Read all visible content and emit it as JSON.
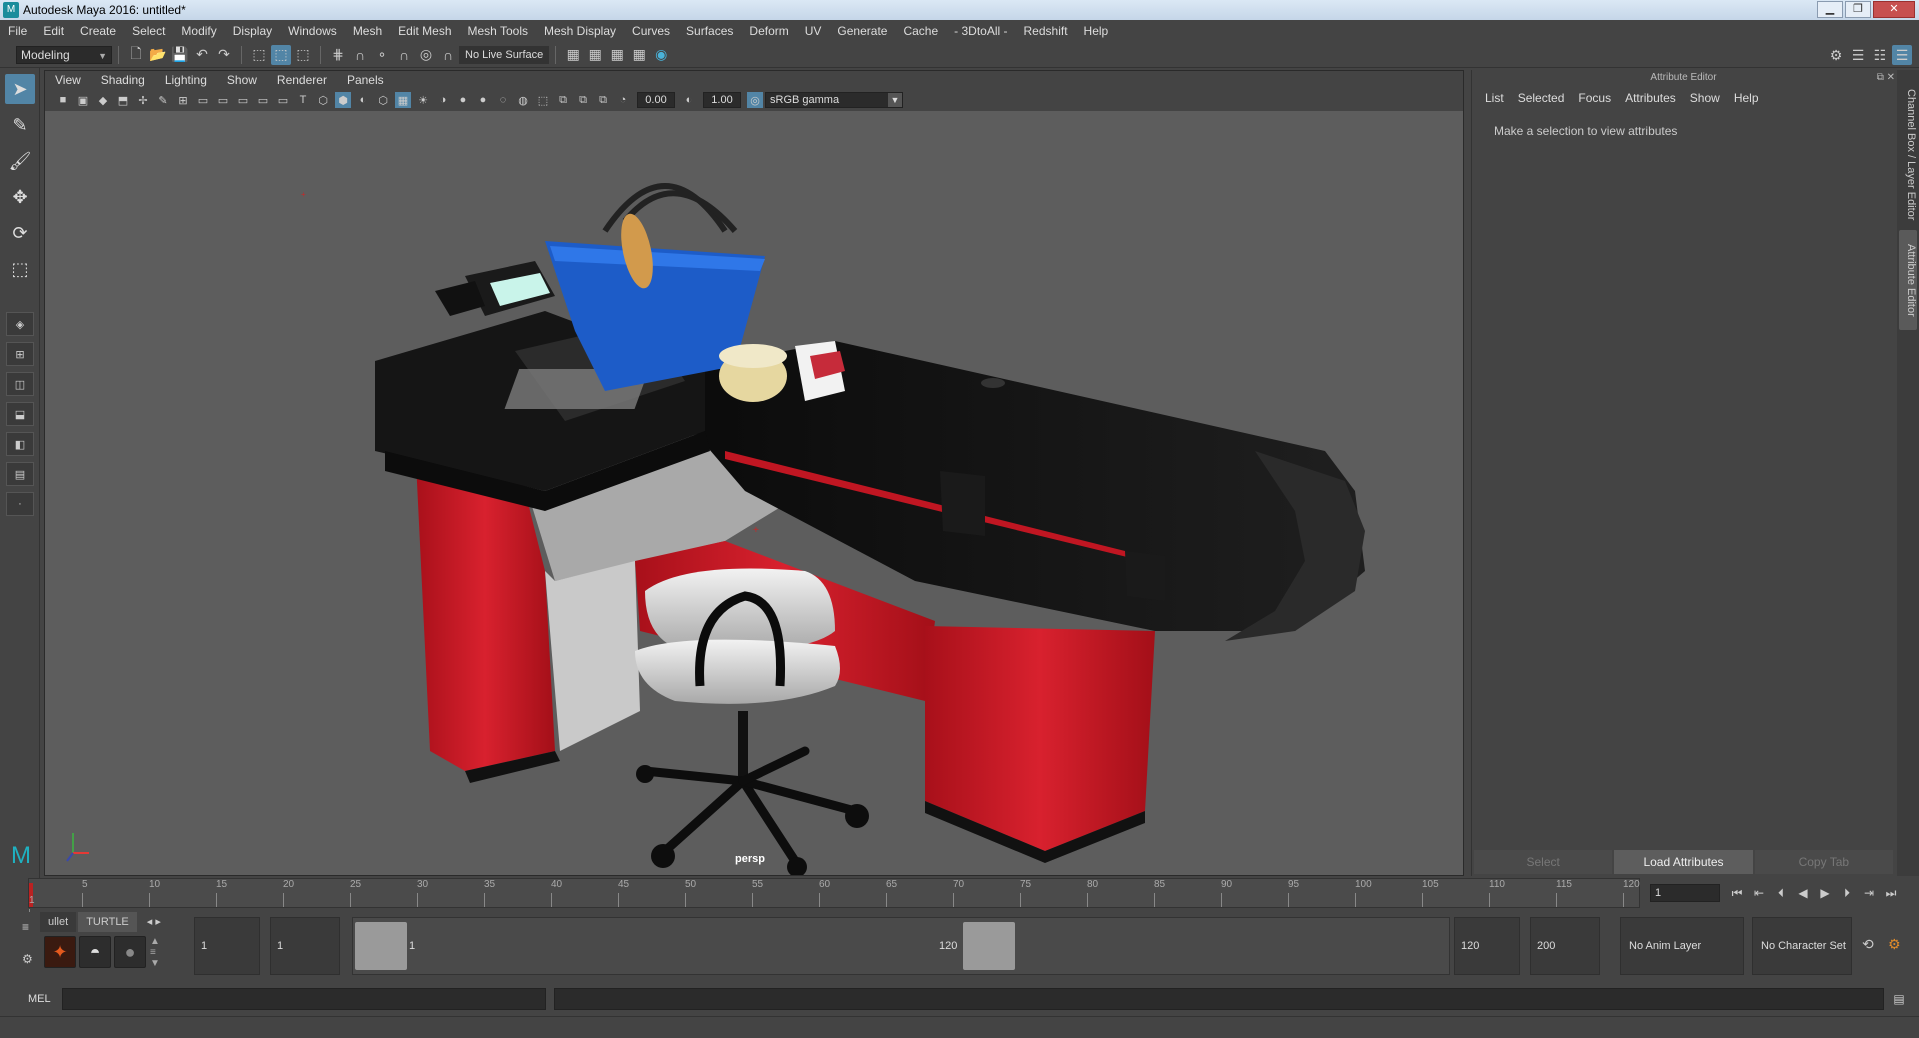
{
  "window": {
    "title": "Autodesk Maya 2016: untitled*",
    "app_icon": "maya-logo-icon"
  },
  "menus": [
    "File",
    "Edit",
    "Create",
    "Select",
    "Modify",
    "Display",
    "Windows",
    "Mesh",
    "Edit Mesh",
    "Mesh Tools",
    "Mesh Display",
    "Curves",
    "Surfaces",
    "Deform",
    "UV",
    "Generate",
    "Cache",
    "- 3DtoAll -",
    "Redshift",
    "Help"
  ],
  "status_line": {
    "mode": "Modeling",
    "live_surface": "No Live Surface"
  },
  "viewport": {
    "menus": [
      "View",
      "Shading",
      "Lighting",
      "Show",
      "Renderer",
      "Panels"
    ],
    "exposure": "0.00",
    "gamma": "1.00",
    "color_space": "sRGB gamma",
    "camera_label": "persp"
  },
  "attribute_editor": {
    "title": "Attribute Editor",
    "menus": [
      "List",
      "Selected",
      "Focus",
      "Attributes",
      "Show",
      "Help"
    ],
    "message": "Make a selection to view attributes",
    "buttons": {
      "select": "Select",
      "load": "Load Attributes",
      "copy": "Copy Tab"
    }
  },
  "side_tabs": {
    "channel_box": "Channel Box / Layer Editor",
    "attr_editor": "Attribute Editor"
  },
  "timeline": {
    "ticks": [
      "5",
      "10",
      "15",
      "20",
      "25",
      "30",
      "35",
      "40",
      "45",
      "50",
      "55",
      "60",
      "65",
      "70",
      "75",
      "80",
      "85",
      "90",
      "95",
      "100",
      "105",
      "110",
      "115",
      "120"
    ],
    "start_tick": "1",
    "current_frame": "1"
  },
  "shelf": {
    "tabs": [
      "ullet",
      "TURTLE"
    ],
    "active_tab": "TURTLE"
  },
  "range": {
    "start": "1",
    "playback_start": "1",
    "slider_start": "1",
    "slider_end": "120",
    "playback_end": "120",
    "end": "200",
    "anim_layer": "No Anim Layer",
    "character_set": "No Character Set"
  },
  "command_line": {
    "label": "MEL"
  }
}
